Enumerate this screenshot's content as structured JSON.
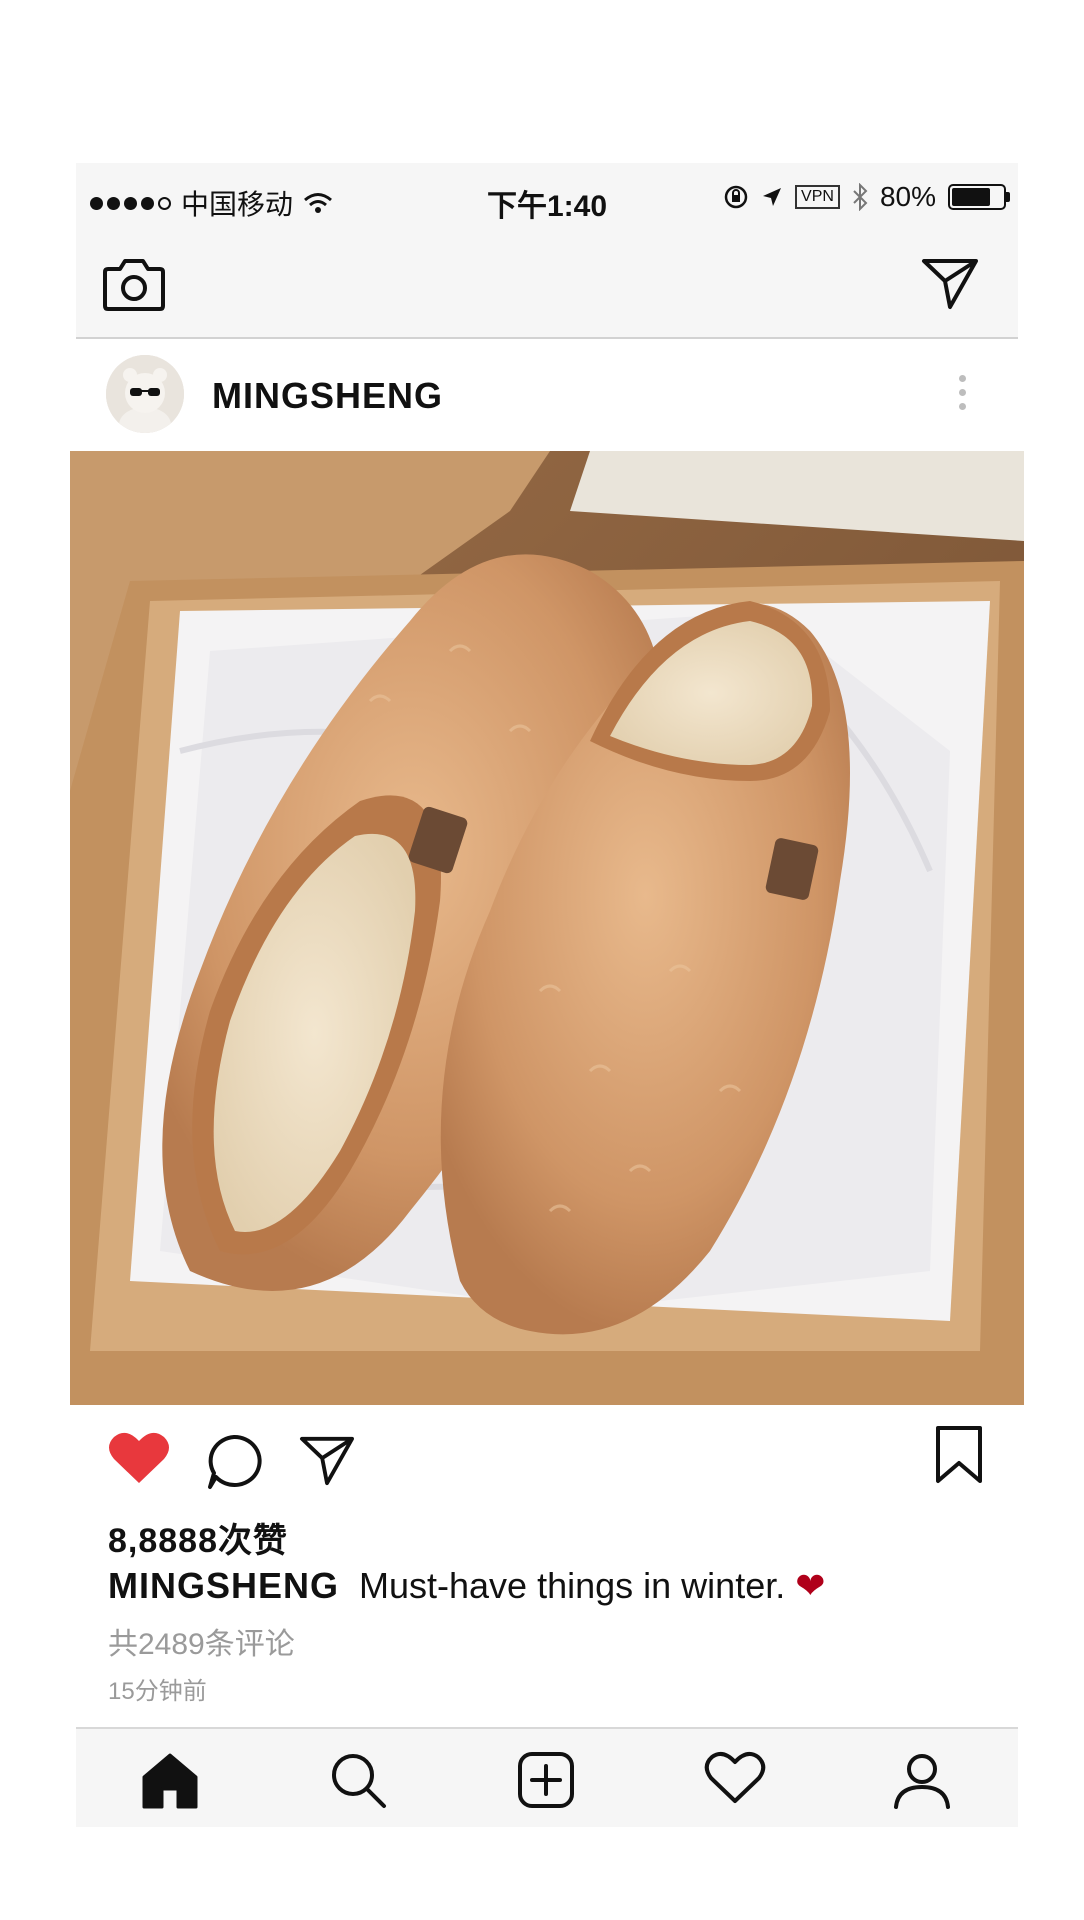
{
  "status_bar": {
    "carrier": "中国移动",
    "time": "下午1:40",
    "vpn_label": "VPN",
    "battery": "80%",
    "battery_level": 0.8,
    "signal_bars_filled": 4,
    "signal_bars_total": 5
  },
  "post": {
    "username": "MINGSHENG",
    "likes": "8,8888次赞",
    "caption_user": "MINGSHENG",
    "caption_text": "Must-have things in winter.",
    "caption_emoji": "❤",
    "comments": "共2489条评论",
    "time_ago": "15分钟前",
    "liked": true,
    "photo_subject": "fluffy tan slippers in cardboard box"
  },
  "colors": {
    "like_red": "#e8383d",
    "caption_heart": "#b0001a",
    "muted_text": "#9a9a9a",
    "bar_bg": "#f6f6f6"
  },
  "icons": {
    "top_left": "camera-icon",
    "top_right": "send-icon",
    "actions": [
      "heart-icon",
      "comment-icon",
      "share-icon",
      "bookmark-icon"
    ],
    "tabs": [
      "home-icon",
      "search-icon",
      "add-post-icon",
      "activity-heart-icon",
      "profile-icon"
    ],
    "active_tab": "home"
  }
}
